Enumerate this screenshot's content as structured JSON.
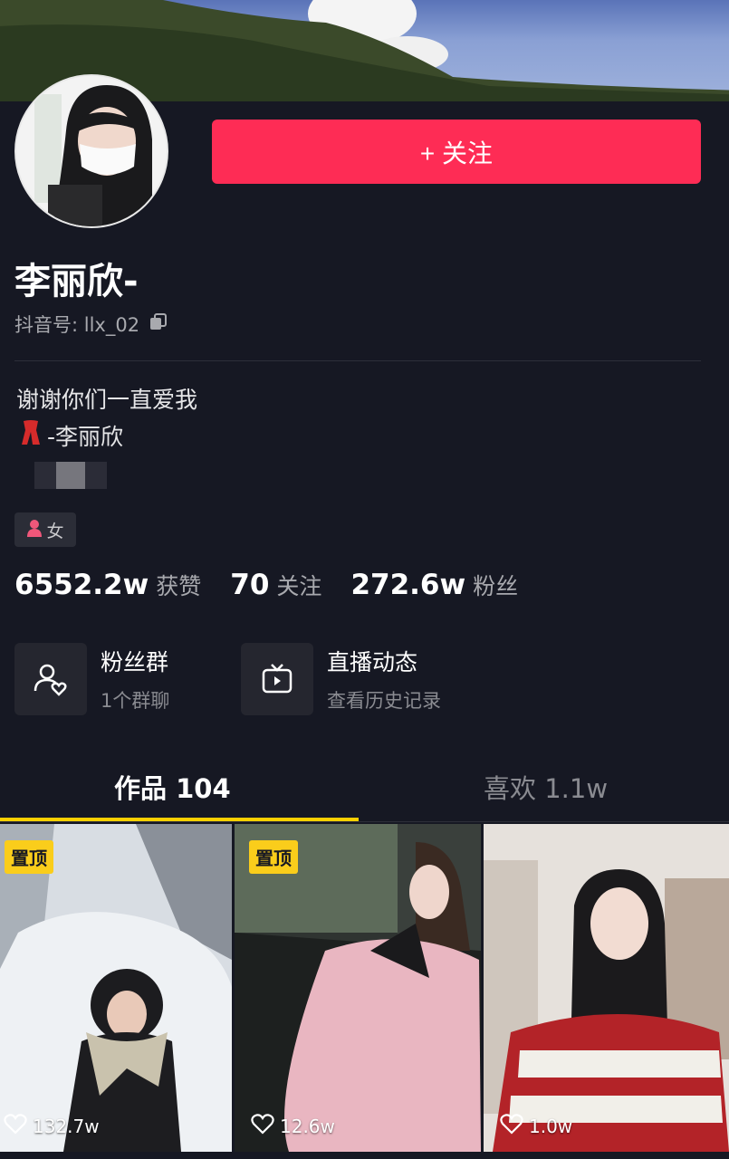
{
  "profile": {
    "follow_label": "+ 关注",
    "name": "李丽欣-",
    "id_prefix": "抖音号:",
    "id_value": "llx_02",
    "bio_line1": "谢谢你们一直爱我",
    "bio_line2": "-李丽欣",
    "gender": "女"
  },
  "stats": [
    {
      "num": "6552.2w",
      "label": "获赞"
    },
    {
      "num": "70",
      "label": "关注"
    },
    {
      "num": "272.6w",
      "label": "粉丝"
    }
  ],
  "cards": [
    {
      "title": "粉丝群",
      "subtitle": "1个群聊",
      "icon": "fan-group-icon"
    },
    {
      "title": "直播动态",
      "subtitle": "查看历史记录",
      "icon": "live-tv-icon"
    }
  ],
  "tabs": [
    {
      "label": "作品 104",
      "active": true
    },
    {
      "label": "喜欢 1.1w",
      "active": false
    }
  ],
  "videos": [
    {
      "pinned": "置顶",
      "likes": "132.7w"
    },
    {
      "pinned": "置顶",
      "likes": "12.6w"
    },
    {
      "pinned": "",
      "likes": "1.0w"
    }
  ],
  "colors": {
    "background": "#161823",
    "accent": "#fe2c55",
    "tab_indicator": "#fdd000",
    "pin_badge": "#facd1b"
  }
}
